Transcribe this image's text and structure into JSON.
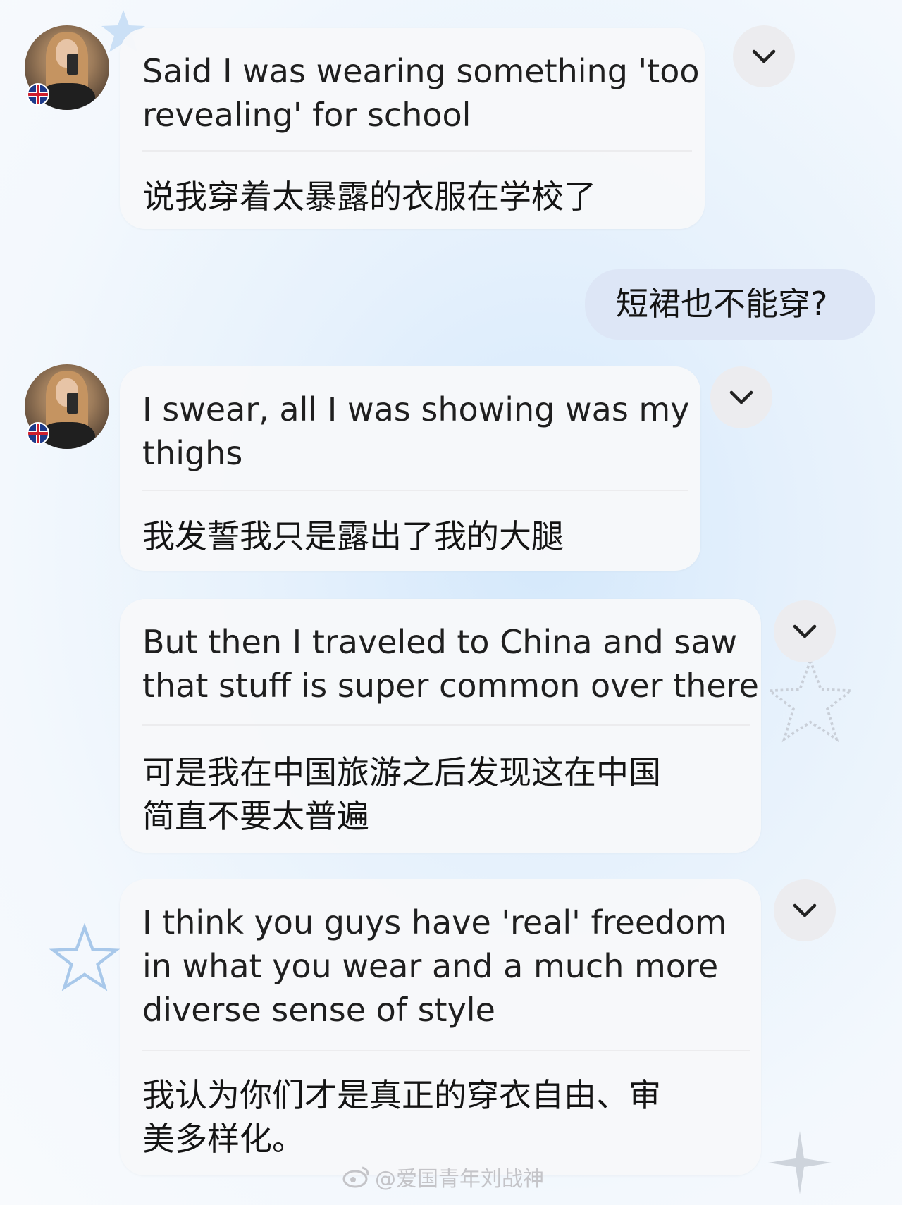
{
  "messages": [
    {
      "sender": "other",
      "english": [
        "Said I was wearing something 'too",
        "revealing' for school"
      ],
      "translation": [
        "说我穿着太暴露的衣服在学校了"
      ]
    },
    {
      "sender": "self",
      "text": "短裙也不能穿?"
    },
    {
      "sender": "other",
      "english": [
        "I swear, all I was showing was my",
        "thighs"
      ],
      "translation": [
        "我发誓我只是露出了我的大腿"
      ]
    },
    {
      "sender": "other",
      "english": [
        "But then I traveled to China and saw",
        "that stuff is super common over there"
      ],
      "translation": [
        "可是我在中国旅游之后发现这在中国",
        "简直不要太普遍"
      ]
    },
    {
      "sender": "other",
      "english": [
        "I think you guys have 'real' freedom",
        "in what you wear and a much more",
        "diverse sense of style"
      ],
      "translation": [
        "我认为你们才是真正的穿衣自由、审",
        "美多样化。"
      ]
    }
  ],
  "watermark": "@爱国青年刘战神",
  "icons": {
    "expand": "chevron-down-icon",
    "flag": "uk-flag-icon",
    "watermark_logo": "weibo-logo-icon"
  },
  "colors": {
    "bubble": "#f7f8fa",
    "sent_bubble": "#dde6f6",
    "chevron_bg": "#ececef"
  }
}
